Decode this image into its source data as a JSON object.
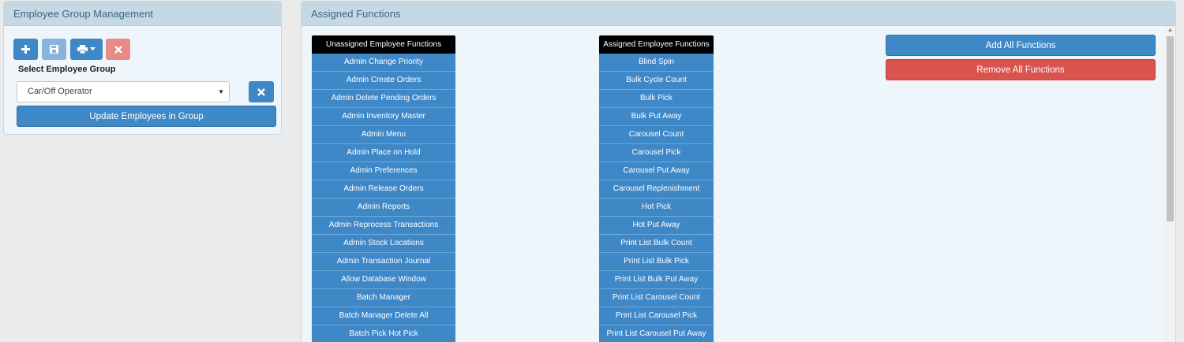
{
  "left_panel": {
    "title": "Employee Group Management",
    "toolbar": {
      "add_icon": "plus-icon",
      "save_icon": "save-icon",
      "print_icon": "print-icon",
      "delete_icon": "close-icon"
    },
    "select_label": "Select Employee Group",
    "selected_group": "Car/Off Operator",
    "update_button": "Update Employees in Group"
  },
  "right_panel": {
    "title": "Assigned Functions",
    "unassigned": {
      "header": "Unassigned Employee Functions",
      "items": [
        "Admin Change Priority",
        "Admin Create Orders",
        "Admin Delete Pending Orders",
        "Admin Inventory Master",
        "Admin Menu",
        "Admin Place on Hold",
        "Admin Preferences",
        "Admin Release Orders",
        "Admin Reports",
        "Admin Reprocess Transactions",
        "Admin Stock Locations",
        "Admin Transaction Journal",
        "Allow Database Window",
        "Batch Manager",
        "Batch Manager Delete All",
        "Batch Pick Hot Pick"
      ]
    },
    "assigned": {
      "header": "Assigned Employee Functions",
      "items": [
        "Blind Spin",
        "Bulk Cycle Count",
        "Bulk Pick",
        "Bulk Put Away",
        "Carousel Count",
        "Carousel Pick",
        "Carousel Put Away",
        "Carousel Replenishment",
        "Hot Pick",
        "Hot Put Away",
        "Print List Bulk Count",
        "Print List Bulk Pick",
        "Print List Bulk Put Away",
        "Print List Carousel Count",
        "Print List Carousel Pick",
        "Print List Carousel Put Away"
      ]
    },
    "add_all_button": "Add All Functions",
    "remove_all_button": "Remove All Functions"
  },
  "colors": {
    "primary": "#3f88c8",
    "danger": "#d9534f",
    "panel_header": "#c5d9e5"
  }
}
